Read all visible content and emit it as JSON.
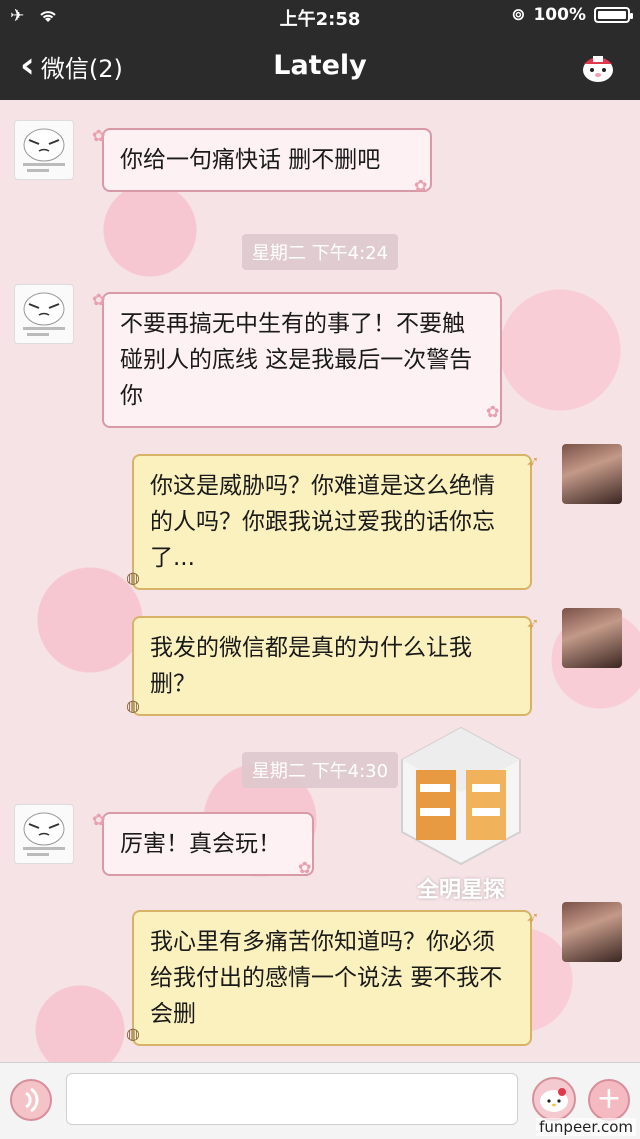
{
  "status_bar": {
    "time": "上午2:58",
    "battery": "100%"
  },
  "nav": {
    "back_label": "微信(2)",
    "title": "Lately"
  },
  "messages": [
    {
      "side": "left",
      "text": "你给一句痛快话 删不删吧"
    },
    {
      "side": "left",
      "text": "不要再搞无中生有的事了！不要触碰别人的底线 这是我最后一次警告你"
    },
    {
      "side": "right",
      "text": "你这是威胁吗？你难道是这么绝情的人吗？你跟我说过爱我的话你忘了..."
    },
    {
      "side": "right",
      "text": "我发的微信都是真的为什么让我删？"
    },
    {
      "side": "left",
      "text": "厉害！真会玩！"
    },
    {
      "side": "right",
      "text": "我心里有多痛苦你知道吗？你必须给我付出的感情一个说法 要不我不会删"
    }
  ],
  "timestamps": [
    "星期二 下午4:24",
    "星期二 下午4:30"
  ],
  "watermark": {
    "text": "全明星探"
  },
  "footer": {
    "site": "funpeer.com"
  },
  "colors": {
    "nav_bg": "#2b2b2b",
    "left_bubble": "#fdf1f4",
    "right_bubble": "#fbf1bf",
    "chat_bg": "#f6e3e5"
  }
}
